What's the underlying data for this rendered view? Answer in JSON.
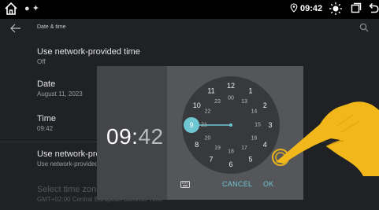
{
  "statusbar": {
    "clock": "09:42",
    "icons": [
      "home-icon",
      "signal-dots-icon",
      "location-icon",
      "brightness-icon",
      "recent-windows-icon",
      "back-icon"
    ]
  },
  "appbar": {
    "title": "Date & time",
    "icons": [
      "back-arrow-icon",
      "search-icon"
    ]
  },
  "settings": {
    "auto_time": {
      "title": "Use network-provided time",
      "value": "Off"
    },
    "date": {
      "title": "Date",
      "value": "August 11, 2023"
    },
    "time": {
      "title": "Time",
      "value": "09:42"
    },
    "auto_zone": {
      "title": "Use network-provided time zone",
      "value": "Use network-provided time zone"
    },
    "zone": {
      "title": "Select time zone",
      "value": "GMT+02:00 Central European Summer Time"
    }
  },
  "picker": {
    "hour": "09",
    "separator": ":",
    "minute": "42",
    "selected_hour": "9",
    "outer_hours": [
      "12",
      "1",
      "2",
      "3",
      "4",
      "5",
      "6",
      "7",
      "8",
      "9",
      "10",
      "11"
    ],
    "inner_hours": [
      "00",
      "13",
      "14",
      "15",
      "16",
      "17",
      "18",
      "19",
      "20",
      "21",
      "22",
      "23"
    ],
    "cancel_label": "CANCEL",
    "ok_label": "OK",
    "keyboard_icon": "keyboard-icon"
  },
  "colors": {
    "accent": "#6fc6d3",
    "toggle_on": "#2e7d6e",
    "hand": "#f2b71a"
  }
}
